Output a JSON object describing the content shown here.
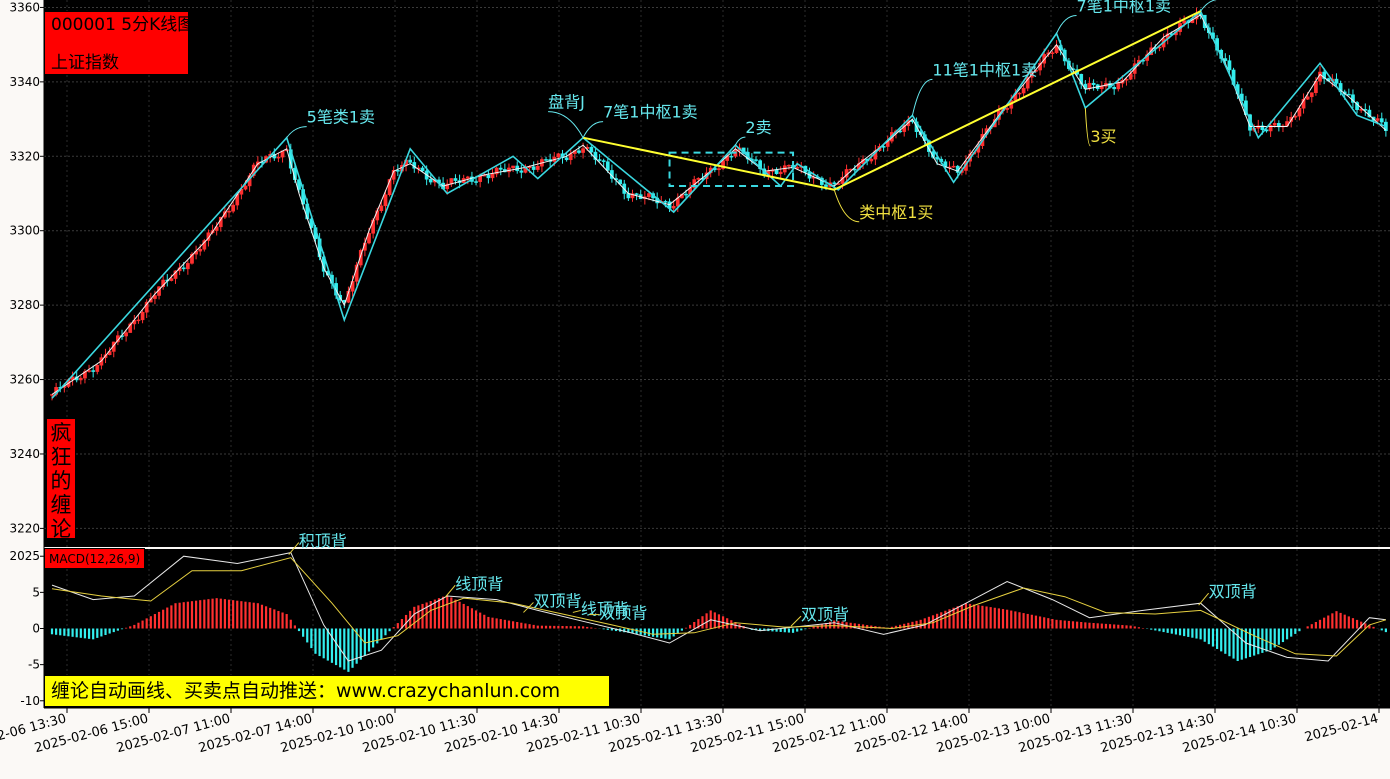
{
  "header": {
    "code_title": "000001 5分K线图",
    "index_name": "上证指数"
  },
  "side_label": "疯狂的缠论",
  "banner": "缠论自动画线、买卖点自动推送：www.crazychanlun.com",
  "colors": {
    "up": "#ff3030",
    "down": "#33eeee",
    "background": "#000000",
    "stroke": "#3ad8e0",
    "trend": "#ffff30",
    "annotation": "#66e8ee",
    "annotation_yellow": "#f0e040"
  },
  "chart_data": [
    {
      "type": "candlestick",
      "title": "000001 5分K线图",
      "subtitle": "上证指数",
      "ylim": [
        3215,
        3362
      ],
      "yticks": [
        3220,
        3240,
        3260,
        3280,
        3300,
        3320,
        3340,
        3360
      ],
      "x_tick_labels": [
        "2025-02-06 13:30",
        "2025-02-06 15:00",
        "2025-02-07 11:00",
        "2025-02-07 14:00",
        "2025-02-10 10:00",
        "2025-02-10 11:30",
        "2025-02-10 14:30",
        "2025-02-11 10:30",
        "2025-02-11 13:30",
        "2025-02-11 15:00",
        "2025-02-12 11:00",
        "2025-02-12 14:00",
        "2025-02-13 10:00",
        "2025-02-13 11:30",
        "2025-02-13 14:30",
        "2025-02-14 10:30",
        "2025-02-14"
      ],
      "grid": true,
      "stroke_points": [
        [
          0,
          3255
        ],
        [
          57,
          3325
        ],
        [
          71,
          3276
        ],
        [
          87,
          3322
        ],
        [
          96,
          3310
        ],
        [
          112,
          3320
        ],
        [
          118,
          3314
        ],
        [
          129,
          3325
        ],
        [
          151,
          3305
        ],
        [
          166,
          3323
        ],
        [
          177,
          3312
        ],
        [
          181,
          3318
        ],
        [
          191,
          3311
        ],
        [
          209,
          3331
        ],
        [
          219,
          3313
        ],
        [
          244,
          3353
        ],
        [
          251,
          3333
        ],
        [
          279,
          3359
        ],
        [
          293,
          3325
        ],
        [
          308,
          3345
        ],
        [
          317,
          3331
        ],
        [
          324,
          3328
        ]
      ],
      "price_path": [
        [
          0,
          3256
        ],
        [
          12,
          3265
        ],
        [
          25,
          3283
        ],
        [
          38,
          3298
        ],
        [
          50,
          3318
        ],
        [
          57,
          3322
        ],
        [
          60,
          3310
        ],
        [
          66,
          3290
        ],
        [
          71,
          3280
        ],
        [
          77,
          3300
        ],
        [
          83,
          3316
        ],
        [
          87,
          3318
        ],
        [
          95,
          3312
        ],
        [
          105,
          3315
        ],
        [
          115,
          3317
        ],
        [
          125,
          3320
        ],
        [
          129,
          3323
        ],
        [
          140,
          3310
        ],
        [
          150,
          3307
        ],
        [
          160,
          3316
        ],
        [
          166,
          3322
        ],
        [
          173,
          3316
        ],
        [
          180,
          3317
        ],
        [
          190,
          3312
        ],
        [
          196,
          3318
        ],
        [
          203,
          3324
        ],
        [
          209,
          3330
        ],
        [
          215,
          3318
        ],
        [
          220,
          3316
        ],
        [
          232,
          3334
        ],
        [
          244,
          3350
        ],
        [
          251,
          3338
        ],
        [
          260,
          3340
        ],
        [
          270,
          3352
        ],
        [
          279,
          3358
        ],
        [
          285,
          3345
        ],
        [
          291,
          3328
        ],
        [
          300,
          3328
        ],
        [
          308,
          3342
        ],
        [
          315,
          3336
        ],
        [
          324,
          3327
        ]
      ],
      "trend_lines": [
        {
          "from": [
            129,
            3325
          ],
          "to": [
            190,
            3311
          ]
        },
        {
          "from": [
            190,
            3311
          ],
          "to": [
            279,
            3359
          ]
        }
      ],
      "zhongshu_box": {
        "from_x": 150,
        "to_x": 180,
        "low": 3312,
        "high": 3321
      },
      "annotations": [
        {
          "text": "5笔类1卖",
          "at": [
            57,
            3325
          ],
          "color": "cyan"
        },
        {
          "text": "盘背J",
          "at": [
            129,
            3325
          ],
          "color": "cyan"
        },
        {
          "text": "7笔1中枢1卖",
          "at": [
            129,
            3325
          ],
          "color": "cyan"
        },
        {
          "text": "2卖",
          "at": [
            166,
            3323
          ],
          "color": "cyan"
        },
        {
          "text": "类中枢1买",
          "at": [
            190,
            3311
          ],
          "color": "yellow"
        },
        {
          "text": "11笔1中枢1卖",
          "at": [
            209,
            3331
          ],
          "color": "cyan"
        },
        {
          "text": "7笔1中枢1卖",
          "at": [
            244,
            3353
          ],
          "color": "cyan"
        },
        {
          "text": "3买",
          "at": [
            251,
            3333
          ],
          "color": "yellow"
        },
        {
          "text": "5笔类1卖",
          "at": [
            279,
            3359
          ],
          "color": "cyan"
        }
      ],
      "n_bars": 325
    },
    {
      "type": "bar+line",
      "title": "MACD(12,26,9)",
      "ylim": [
        -11,
        11
      ],
      "yticks": [
        -10,
        -5,
        0,
        5,
        10
      ],
      "ytick_labels": [
        "-10",
        "-5",
        "0",
        "5",
        "2025"
      ],
      "macd_path": [
        [
          0,
          -0.8
        ],
        [
          10,
          -1.5
        ],
        [
          20,
          0.5
        ],
        [
          30,
          3.5
        ],
        [
          40,
          4.2
        ],
        [
          50,
          3.5
        ],
        [
          57,
          2.0
        ],
        [
          64,
          -3.5
        ],
        [
          72,
          -6.0
        ],
        [
          80,
          -1.5
        ],
        [
          88,
          3.0
        ],
        [
          96,
          4.6
        ],
        [
          106,
          1.6
        ],
        [
          118,
          0.4
        ],
        [
          129,
          0.3
        ],
        [
          140,
          -0.6
        ],
        [
          150,
          -1.5
        ],
        [
          160,
          2.5
        ],
        [
          170,
          -0.2
        ],
        [
          180,
          -0.6
        ],
        [
          190,
          1.1
        ],
        [
          203,
          0.1
        ],
        [
          211,
          1.2
        ],
        [
          222,
          3.5
        ],
        [
          232,
          2.6
        ],
        [
          244,
          1.2
        ],
        [
          252,
          0.8
        ],
        [
          262,
          0.4
        ],
        [
          279,
          -1.5
        ],
        [
          288,
          -4.5
        ],
        [
          296,
          -3.0
        ],
        [
          304,
          0.0
        ],
        [
          312,
          2.4
        ],
        [
          324,
          -0.5
        ]
      ],
      "dif_path": [
        [
          0,
          6.0
        ],
        [
          10,
          4.0
        ],
        [
          20,
          4.5
        ],
        [
          32,
          10.0
        ],
        [
          45,
          9.0
        ],
        [
          58,
          10.5
        ],
        [
          66,
          0.5
        ],
        [
          72,
          -4.5
        ],
        [
          80,
          -3.0
        ],
        [
          88,
          2.0
        ],
        [
          96,
          4.5
        ],
        [
          108,
          4.0
        ],
        [
          118,
          2.5
        ],
        [
          129,
          1.0
        ],
        [
          140,
          -0.5
        ],
        [
          150,
          -2.0
        ],
        [
          160,
          1.2
        ],
        [
          172,
          -0.3
        ],
        [
          190,
          0.8
        ],
        [
          202,
          -0.8
        ],
        [
          212,
          0.5
        ],
        [
          222,
          3.5
        ],
        [
          232,
          6.5
        ],
        [
          243,
          4.0
        ],
        [
          252,
          1.5
        ],
        [
          265,
          2.5
        ],
        [
          279,
          3.5
        ],
        [
          290,
          -2.0
        ],
        [
          300,
          -4.0
        ],
        [
          310,
          -4.5
        ],
        [
          320,
          1.5
        ],
        [
          324,
          1.2
        ]
      ],
      "dea_path": [
        [
          0,
          5.5
        ],
        [
          12,
          4.5
        ],
        [
          24,
          3.8
        ],
        [
          34,
          8.0
        ],
        [
          46,
          8.0
        ],
        [
          58,
          9.8
        ],
        [
          68,
          3.5
        ],
        [
          76,
          -2.0
        ],
        [
          84,
          -1.0
        ],
        [
          92,
          2.5
        ],
        [
          100,
          4.2
        ],
        [
          112,
          3.5
        ],
        [
          124,
          2.0
        ],
        [
          136,
          0.5
        ],
        [
          146,
          -0.8
        ],
        [
          156,
          -0.6
        ],
        [
          166,
          0.8
        ],
        [
          178,
          0.2
        ],
        [
          190,
          0.4
        ],
        [
          204,
          0.0
        ],
        [
          214,
          0.8
        ],
        [
          224,
          3.2
        ],
        [
          236,
          5.6
        ],
        [
          246,
          4.4
        ],
        [
          256,
          2.2
        ],
        [
          268,
          2.0
        ],
        [
          279,
          2.5
        ],
        [
          292,
          -1.0
        ],
        [
          302,
          -3.5
        ],
        [
          312,
          -3.8
        ],
        [
          320,
          0.5
        ],
        [
          324,
          1.2
        ]
      ],
      "signals": [
        {
          "text": "积顶背",
          "at": [
            58,
            10.5
          ]
        },
        {
          "text": "线顶背",
          "at": [
            96,
            4.6
          ]
        },
        {
          "text": "双顶背",
          "at": [
            115,
            2.5
          ]
        },
        {
          "text": "线顶背",
          "at": [
            127,
            2.5
          ]
        },
        {
          "text": "双顶背",
          "at": [
            131,
            2.2
          ]
        },
        {
          "text": "双顶背",
          "at": [
            180,
            0.6
          ]
        },
        {
          "text": "双顶背",
          "at": [
            279,
            3.5
          ]
        }
      ]
    }
  ]
}
